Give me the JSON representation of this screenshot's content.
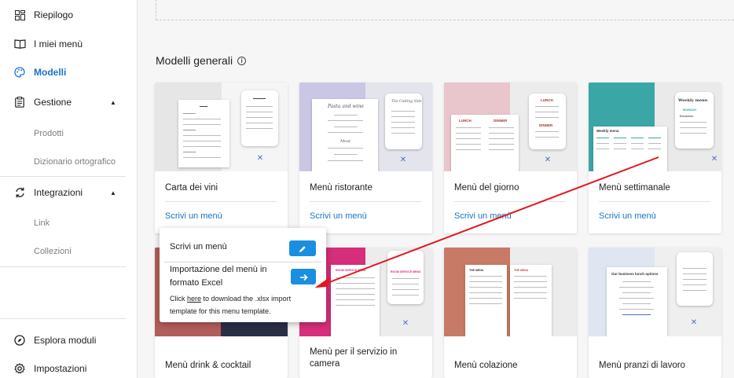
{
  "sidebar": {
    "items": [
      {
        "label": "Riepilogo",
        "icon": "dashboard-icon"
      },
      {
        "label": "I miei menù",
        "icon": "book-icon"
      },
      {
        "label": "Modelli",
        "icon": "palette-icon"
      },
      {
        "label": "Gestione",
        "icon": "clipboard-icon"
      },
      {
        "label": "Integrazioni",
        "icon": "sync-icon"
      }
    ],
    "gestione_sub": [
      "Prodotti",
      "Dizionario ortografico"
    ],
    "integrazioni_sub": [
      "Link",
      "Collezioni"
    ],
    "bottom": [
      {
        "label": "Esplora moduli",
        "icon": "compass-icon"
      },
      {
        "label": "Impostazioni",
        "icon": "gear-icon"
      }
    ],
    "active_color": "#1a73c7"
  },
  "main": {
    "section_title": "Modelli generali",
    "action_label": "Scrivi un menù",
    "cards": [
      {
        "title": "Carta dei vini"
      },
      {
        "title": "Menù ristorante"
      },
      {
        "title": "Menù del giorno"
      },
      {
        "title": "Menù settimanale"
      },
      {
        "title": "Menù drink & cocktail"
      },
      {
        "title": "Menù per il servizio in camera"
      },
      {
        "title": "Menù colazione"
      },
      {
        "title": "Menù pranzi di lavoro"
      }
    ]
  },
  "popup": {
    "write_label": "Scrivi un menù",
    "import_label": "Importazione del menù in formato Excel",
    "help_prefix": "Click ",
    "help_link": "here",
    "help_suffix": " to download the .xlsx import template for this menu template."
  },
  "thumbs": {
    "restaurant_script": "Pasta and wine",
    "restaurant_script2": "Meat",
    "restaurant_phone": "The Cutting Side",
    "daily_lunch": "LUNCH",
    "daily_dinner": "DINNER",
    "weekly_title": "Weekly menu",
    "weekly_day": "MONDAY",
    "weekly_meal": "Breakfast",
    "weekly_small": "Weekly menu",
    "room_title": "ROOM SERVICE MENU",
    "breakfast_title": "THE MENU",
    "business_title": "Our business lunch options"
  },
  "colors": {
    "accent": "#1a73c7",
    "button": "#1a8fe0",
    "arrow": "#e3161b"
  }
}
